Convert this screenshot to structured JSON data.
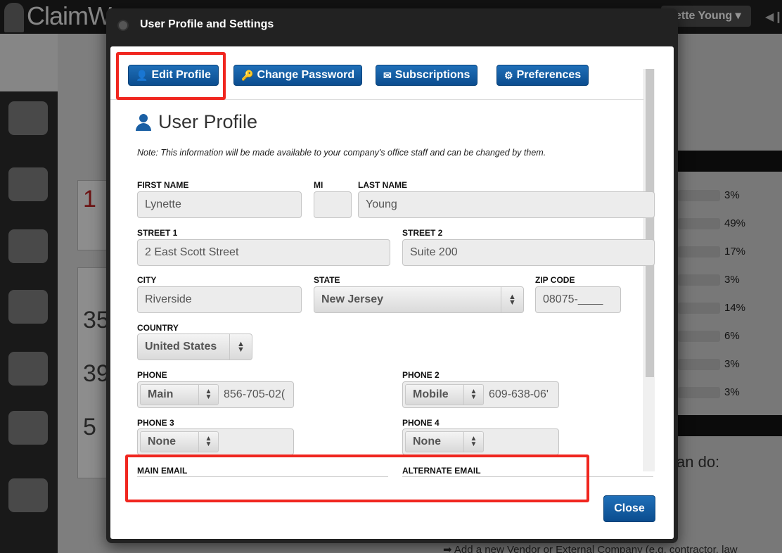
{
  "app": {
    "logo_text": "ClaimW",
    "user_name": "ette Young ▾"
  },
  "background": {
    "percentages": [
      "3%",
      "49%",
      "17%",
      "3%",
      "14%",
      "6%",
      "3%",
      "3%"
    ],
    "cando_text": "an do:",
    "bottom_link": "➡ Add a new Vendor or External Company (e.g. contractor, law",
    "left_numbers": [
      "1",
      "35",
      "39",
      "5"
    ]
  },
  "modal": {
    "title": "User Profile and Settings",
    "tabs": [
      {
        "label": "Edit Profile",
        "icon": "user-icon"
      },
      {
        "label": "Change Password",
        "icon": "key-icon"
      },
      {
        "label": "Subscriptions",
        "icon": "envelope-icon"
      },
      {
        "label": "Preferences",
        "icon": "gear-icon"
      }
    ],
    "section_title": "User Profile",
    "note": "Note: This information will be made available to your company's office staff and can be changed by them.",
    "form": {
      "first_name": {
        "label": "FIRST NAME",
        "value": "Lynette"
      },
      "mi": {
        "label": "MI",
        "value": ""
      },
      "last_name": {
        "label": "LAST NAME",
        "value": "Young"
      },
      "street1": {
        "label": "STREET 1",
        "value": "2 East Scott Street"
      },
      "street2": {
        "label": "STREET 2",
        "value": "Suite 200"
      },
      "city": {
        "label": "CITY",
        "value": "Riverside"
      },
      "state": {
        "label": "STATE",
        "value": "New Jersey"
      },
      "zip": {
        "label": "ZIP CODE",
        "value": "08075-____"
      },
      "country": {
        "label": "COUNTRY",
        "value": "United States"
      },
      "phone": {
        "label": "PHONE",
        "type": "Main",
        "number": "856-705-02("
      },
      "phone2": {
        "label": "PHONE 2",
        "type": "Mobile",
        "number": "609-638-06'"
      },
      "phone3": {
        "label": "PHONE 3",
        "type": "None",
        "number": ""
      },
      "phone4": {
        "label": "PHONE 4",
        "type": "None",
        "number": ""
      },
      "main_email": {
        "label": "MAIN EMAIL"
      },
      "alternate_email": {
        "label": "ALTERNATE EMAIL"
      }
    },
    "close_label": "Close"
  },
  "colors": {
    "accent": "#0b4d8f",
    "highlight": "#f0261f"
  }
}
